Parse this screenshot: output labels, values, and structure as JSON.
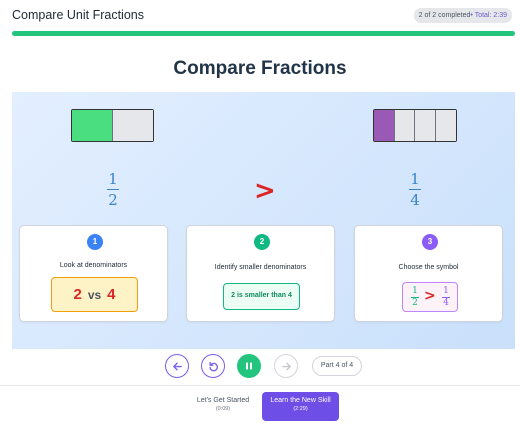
{
  "header": {
    "title": "Compare Unit Fractions",
    "status": "2 of 2 completed",
    "total": "• Total: 2:39",
    "progress": 1.0
  },
  "main": {
    "heading": "Compare Fractions",
    "left_fraction": {
      "numerator": "1",
      "denominator": "2",
      "parts": 2,
      "filled": 1,
      "fill_color": "#4ade80"
    },
    "right_fraction": {
      "numerator": "1",
      "denominator": "4",
      "parts": 4,
      "filled": 1,
      "fill_color": "#9b59b6"
    },
    "comparison_sign": ">",
    "steps": [
      {
        "number": "1",
        "label": "Look at denominators",
        "color": "#3b82f6",
        "left": "2",
        "vs": "vs",
        "right": "4"
      },
      {
        "number": "2",
        "label": "Identify smaller denominators",
        "color": "#10b981",
        "result": "2 is smaller than 4"
      },
      {
        "number": "3",
        "label": "Choose the symbol",
        "color": "#8b5cf6",
        "sym_left_num": "1",
        "sym_left_den": "2",
        "sym": ">",
        "sym_right_num": "1",
        "sym_right_den": "4"
      }
    ]
  },
  "controls": {
    "back_icon": "arrow-left-icon",
    "restart_icon": "restart-icon",
    "pause_icon": "pause-icon",
    "next_icon": "arrow-right-icon",
    "part_label": "Part 4 of 4"
  },
  "footer": {
    "prev_label": "Let's Get Started",
    "prev_time": "(0:09)",
    "next_label": "Learn the New Skill",
    "next_time": "(2:29)"
  }
}
